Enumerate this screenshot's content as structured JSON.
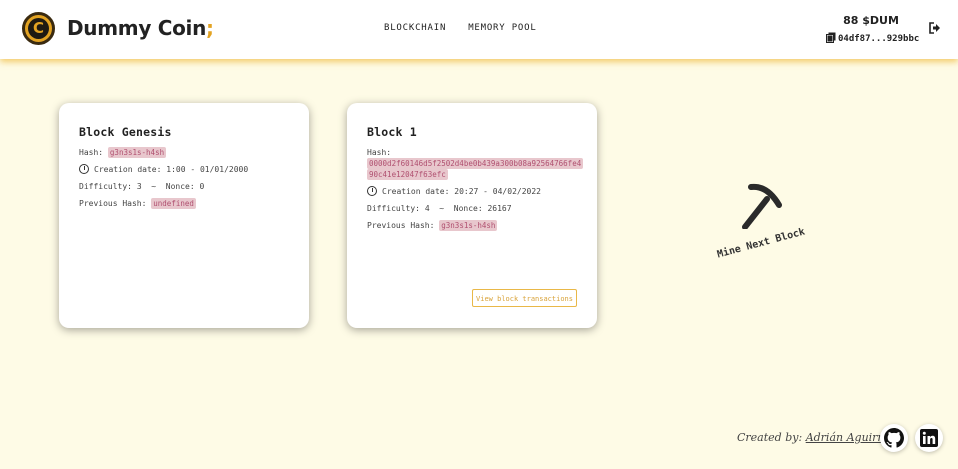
{
  "header": {
    "brand": "Dummy Coin",
    "brand_accent": ";",
    "nav": [
      {
        "label": "BLOCKCHAIN"
      },
      {
        "label": "MEMORY POOL"
      }
    ],
    "balance": "88 $DUM",
    "address": "04df87...929bbc",
    "icons": {
      "logo": "coin-logo-icon",
      "copy": "copy-icon",
      "logout": "logout-icon"
    }
  },
  "blocks": [
    {
      "title": "Block Genesis",
      "hash_label": "Hash:",
      "hash": "g3n3s1s-h4sh",
      "creation_label": "Creation date:",
      "creation_value": "1:00 - 01/01/2000",
      "difficulty_label": "Difficulty:",
      "difficulty": "3",
      "sep": "~",
      "nonce_label": "Nonce:",
      "nonce": "0",
      "prev_label": "Previous Hash:",
      "prev_hash": "undefined"
    },
    {
      "title": "Block 1",
      "hash_label": "Hash:",
      "hash_line1": "0000d2f60146d5f2502d4be0b439a300b08a92564766fe4",
      "hash_line2": "90c41e12047f63efc",
      "creation_label": "Creation date:",
      "creation_value": "20:27 - 04/02/2022",
      "difficulty_label": "Difficulty:",
      "difficulty": "4",
      "sep": "~",
      "nonce_label": "Nonce:",
      "nonce": "26167",
      "prev_label": "Previous Hash:",
      "prev_hash": "g3n3s1s-h4sh",
      "view_button": "View block transactions"
    }
  ],
  "mine": {
    "label": "Mine Next Block",
    "icon": "pickaxe-icon"
  },
  "footer": {
    "created_by": "Created by:",
    "author": "Adrián Aguirre",
    "icons": [
      "github-icon",
      "linkedin-icon"
    ]
  },
  "colors": {
    "accent": "#e3a322",
    "background": "#fefbe6",
    "hash_bg": "#e8c7cd",
    "hash_text": "#b05070"
  }
}
